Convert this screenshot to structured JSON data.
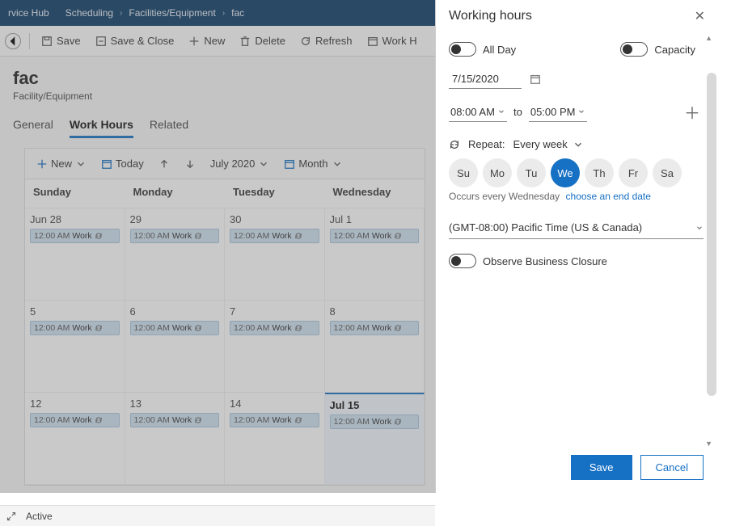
{
  "topbar": {
    "hub": "rvice Hub",
    "crumbs": [
      "Scheduling",
      "Facilities/Equipment",
      "fac"
    ]
  },
  "commands": {
    "save": "Save",
    "saveClose": "Save & Close",
    "new": "New",
    "delete": "Delete",
    "refresh": "Refresh",
    "workh": "Work H"
  },
  "page": {
    "title": "fac",
    "subtitle": "Facility/Equipment"
  },
  "tabs": {
    "general": "General",
    "workHours": "Work Hours",
    "related": "Related"
  },
  "calToolbar": {
    "new": "New",
    "today": "Today",
    "month": "July 2020",
    "view": "Month"
  },
  "calendar": {
    "headers": [
      "Sunday",
      "Monday",
      "Tuesday",
      "Wednesday"
    ],
    "rows": [
      [
        "Jun 28",
        "29",
        "30",
        "Jul 1"
      ],
      [
        "5",
        "6",
        "7",
        "8"
      ],
      [
        "12",
        "13",
        "14",
        "Jul 15"
      ]
    ],
    "selected": "Jul 15",
    "event": {
      "time": "12:00 AM",
      "label": "Work"
    }
  },
  "status": {
    "active": "Active"
  },
  "panel": {
    "title": "Working hours",
    "allDay": "All Day",
    "capacity": "Capacity",
    "date": "7/15/2020",
    "start": "08:00 AM",
    "to": "to",
    "end": "05:00 PM",
    "repeatLabel": "Repeat:",
    "repeatValue": "Every week",
    "dow": [
      "Su",
      "Mo",
      "Tu",
      "We",
      "Th",
      "Fr",
      "Sa"
    ],
    "activeDow": "We",
    "occurs": "Occurs every Wednesday",
    "chooseEnd": "choose an end date",
    "timezone": "(GMT-08:00) Pacific Time (US & Canada)",
    "observe": "Observe Business Closure",
    "save": "Save",
    "cancel": "Cancel"
  }
}
